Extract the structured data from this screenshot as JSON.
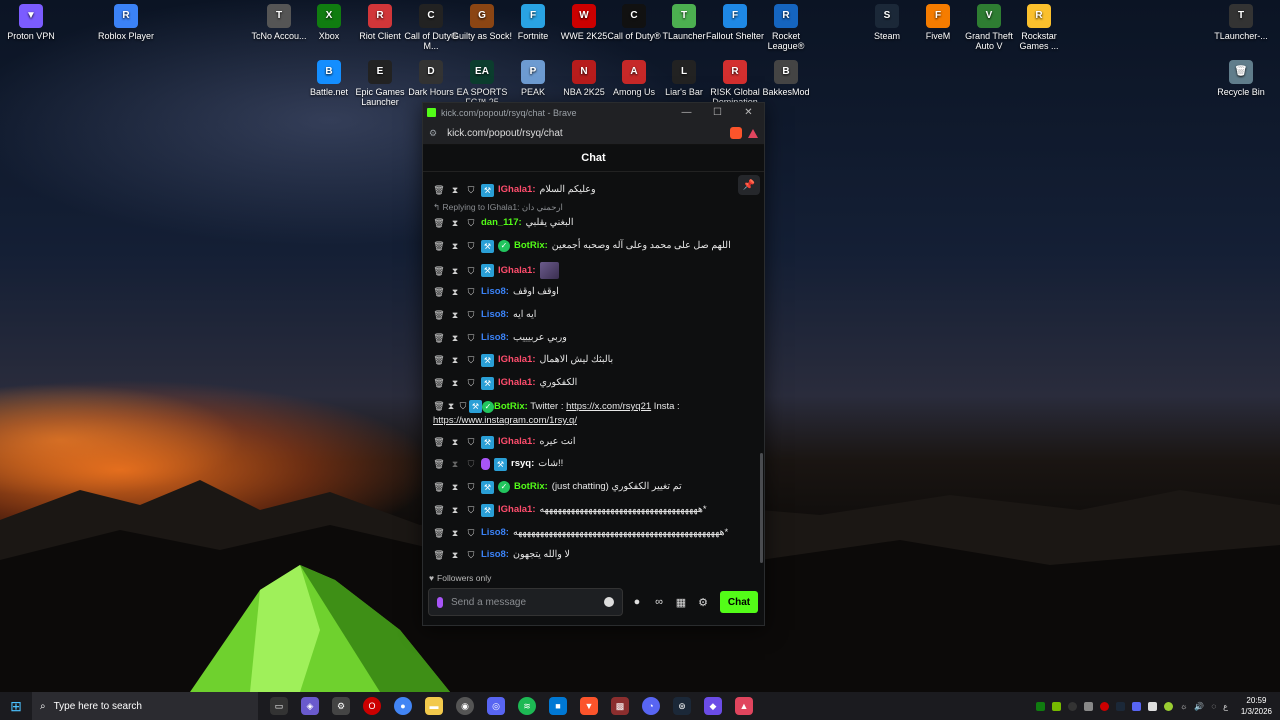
{
  "desktop_icons": [
    {
      "label": "Proton VPN",
      "glyph": "▼",
      "color": "#7b5cff"
    },
    {
      "label": "Roblox Player",
      "glyph": "R",
      "color": "#3b82f6"
    },
    {
      "label": "TcNo Accou...",
      "glyph": "T",
      "color": "#555"
    },
    {
      "label": "Xbox",
      "glyph": "X",
      "color": "#107c10"
    },
    {
      "label": "Riot Client",
      "glyph": "R",
      "color": "#d13639"
    },
    {
      "label": "Call of Duty® M...",
      "glyph": "C",
      "color": "#222"
    },
    {
      "label": "Guilty as Sock!",
      "glyph": "G",
      "color": "#8b4513"
    },
    {
      "label": "Fortnite",
      "glyph": "F",
      "color": "#29a3e3"
    },
    {
      "label": "WWE 2K25",
      "glyph": "W",
      "color": "#c00"
    },
    {
      "label": "Call of Duty®",
      "glyph": "C",
      "color": "#111"
    },
    {
      "label": "TLauncher",
      "glyph": "T",
      "color": "#4caf50"
    },
    {
      "label": "Fallout Shelter",
      "glyph": "F",
      "color": "#1e88e5"
    },
    {
      "label": "Rocket League®",
      "glyph": "R",
      "color": "#1565c0"
    },
    {
      "label": "Steam",
      "glyph": "S",
      "color": "#1b2838"
    },
    {
      "label": "FiveM",
      "glyph": "F",
      "color": "#f57c00"
    },
    {
      "label": "Grand Theft Auto V",
      "glyph": "V",
      "color": "#2e7d32"
    },
    {
      "label": "Rockstar Games ...",
      "glyph": "R",
      "color": "#fbc02d"
    },
    {
      "label": "TLauncher-...",
      "glyph": "T",
      "color": "#333"
    },
    {
      "label": "Battle.net",
      "glyph": "B",
      "color": "#148eff"
    },
    {
      "label": "Epic Games Launcher",
      "glyph": "E",
      "color": "#222"
    },
    {
      "label": "Dark Hours",
      "glyph": "D",
      "color": "#333"
    },
    {
      "label": "EA SPORTS FC™ 25",
      "glyph": "EA",
      "color": "#0b3d2e"
    },
    {
      "label": "PEAK",
      "glyph": "P",
      "color": "#6d9bd1"
    },
    {
      "label": "NBA 2K25",
      "glyph": "N",
      "color": "#b71c1c"
    },
    {
      "label": "Among Us",
      "glyph": "A",
      "color": "#c62828"
    },
    {
      "label": "Liar's Bar",
      "glyph": "L",
      "color": "#222"
    },
    {
      "label": "RISK Global Domination",
      "glyph": "R",
      "color": "#d32f2f"
    },
    {
      "label": "BakkesMod",
      "glyph": "B",
      "color": "#444"
    },
    {
      "label": "Recycle Bin",
      "glyph": "🗑",
      "color": "#607d8b"
    }
  ],
  "browser": {
    "title": "kick.com/popout/rsyq/chat - Brave",
    "url": "kick.com/popout/rsyq/chat",
    "minimize": "—",
    "maximize": "☐",
    "close": "✕"
  },
  "chat": {
    "header": "Chat",
    "reply_to": "Replying to IGhala1: ارحمني دان",
    "messages": [
      {
        "user": "IGhala1",
        "color": "red",
        "badges": [
          "vip"
        ],
        "text": "وعليكم السلام"
      },
      {
        "user": "dan_117",
        "color": "green",
        "badges": [],
        "text": "البغني يقلبي"
      },
      {
        "user": "BotRix",
        "color": "green",
        "badges": [
          "vip",
          "verified"
        ],
        "text": "اللهم صل على محمد وعلى آله وصحبه أجمعين"
      },
      {
        "user": "IGhala1",
        "color": "red",
        "badges": [
          "vip"
        ],
        "text": "",
        "emote": true
      },
      {
        "user": "Liso8",
        "color": "blue",
        "badges": [],
        "text": "اوقف اوقف"
      },
      {
        "user": "Liso8",
        "color": "blue",
        "badges": [],
        "text": "ايه ايه"
      },
      {
        "user": "Liso8",
        "color": "blue",
        "badges": [],
        "text": "وربي عربيييب"
      },
      {
        "user": "IGhala1",
        "color": "red",
        "badges": [
          "vip"
        ],
        "text": "بالبثك ليش الاهمال"
      },
      {
        "user": "IGhala1",
        "color": "red",
        "badges": [
          "vip"
        ],
        "text": "الكفكوري"
      },
      {
        "user": "BotRix",
        "color": "green",
        "badges": [
          "vip",
          "verified"
        ],
        "text": "Twitter :",
        "link1": "https://x.com/rsyq21",
        "text2": "Insta :",
        "link2": "https://www.instagram.com/1rsy.q/"
      },
      {
        "user": "IGhala1",
        "color": "red",
        "badges": [
          "vip"
        ],
        "text": "انت عيره"
      },
      {
        "user": "rsyq",
        "color": "white",
        "badges": [
          "mic",
          "vip"
        ],
        "text": "شات!!"
      },
      {
        "user": "BotRix",
        "color": "green",
        "badges": [
          "vip",
          "verified"
        ],
        "text": "(just chatting) تم تغيير الكفكوري"
      },
      {
        "user": "IGhala1",
        "color": "red",
        "badges": [
          "vip"
        ],
        "text": "ههههههههههههههههههههههههههههههههههههه*"
      },
      {
        "user": "Liso8",
        "color": "blue",
        "badges": [],
        "text": "هههههههههههههههههههههههههههههههههههههههههههههههه*"
      },
      {
        "user": "Liso8",
        "color": "blue",
        "badges": [],
        "text": "لا والله يتجهون"
      }
    ],
    "followers_only": "Followers only",
    "input_placeholder": "Send a message",
    "send_label": "Chat"
  },
  "taskbar": {
    "search_placeholder": "Type here to search",
    "time": "20:59",
    "date": "1/3/2026",
    "lang": "ع"
  }
}
